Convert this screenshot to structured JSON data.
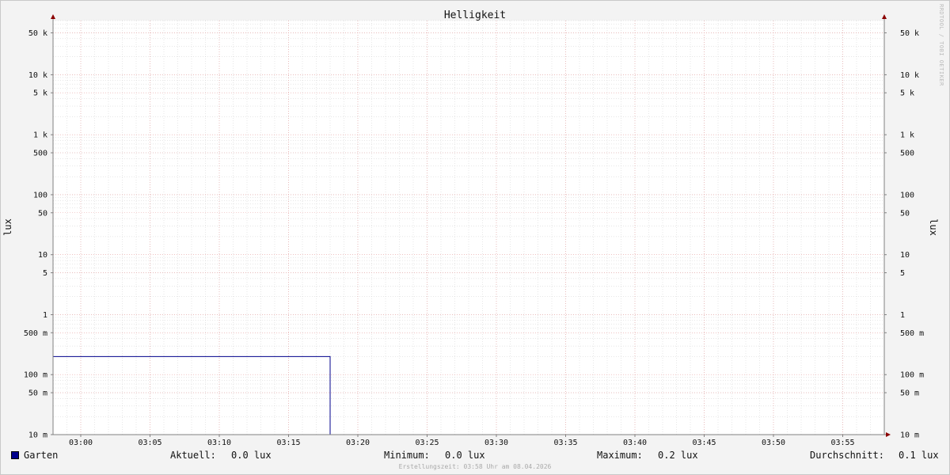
{
  "chart_data": {
    "type": "line",
    "title": "Helligkeit",
    "ylabel": "lux",
    "xlabel": "",
    "y_scale": "log",
    "ylim": [
      0.01,
      80000
    ],
    "xlim": [
      "02:58",
      "03:58"
    ],
    "x_ticks": [
      "03:00",
      "03:05",
      "03:10",
      "03:15",
      "03:20",
      "03:25",
      "03:30",
      "03:35",
      "03:40",
      "03:45",
      "03:50",
      "03:55"
    ],
    "y_ticks": [
      {
        "value": 50000,
        "label": "50 k"
      },
      {
        "value": 10000,
        "label": "10 k"
      },
      {
        "value": 5000,
        "label": "5 k"
      },
      {
        "value": 1000,
        "label": "1 k"
      },
      {
        "value": 500,
        "label": "500"
      },
      {
        "value": 100,
        "label": "100"
      },
      {
        "value": 50,
        "label": "50"
      },
      {
        "value": 10,
        "label": "10"
      },
      {
        "value": 5,
        "label": "5"
      },
      {
        "value": 1,
        "label": "1"
      },
      {
        "value": 0.5,
        "label": "500 m"
      },
      {
        "value": 0.1,
        "label": "100 m"
      },
      {
        "value": 0.05,
        "label": "50 m"
      },
      {
        "value": 0.01,
        "label": "10 m"
      }
    ],
    "grid": true,
    "series": [
      {
        "name": "Garten",
        "color": "#00008c",
        "points": [
          {
            "x": "02:58",
            "y": 0.2
          },
          {
            "x": "03:18",
            "y": 0.2
          },
          {
            "x": "03:18",
            "y": 0.0
          },
          {
            "x": "03:58",
            "y": 0.0
          }
        ]
      }
    ]
  },
  "legend": {
    "series_name": "Garten",
    "current_label": "Aktuell:",
    "current_value": "0.0 lux",
    "min_label": "Minimum:",
    "min_value": "0.0 lux",
    "max_label": "Maximum:",
    "max_value": "0.2 lux",
    "avg_label": "Durchschnitt:",
    "avg_value": "0.1 lux"
  },
  "watermark": "RRDTOOL / TOBI OETIKER",
  "footer": "Erstellungszeit: 03:58 Uhr am 08.04.2026",
  "colors": {
    "major_grid": "#e8a0a0",
    "minor_grid": "#cfcfcf",
    "axis": "#808080",
    "arrow": "#8b0000"
  }
}
